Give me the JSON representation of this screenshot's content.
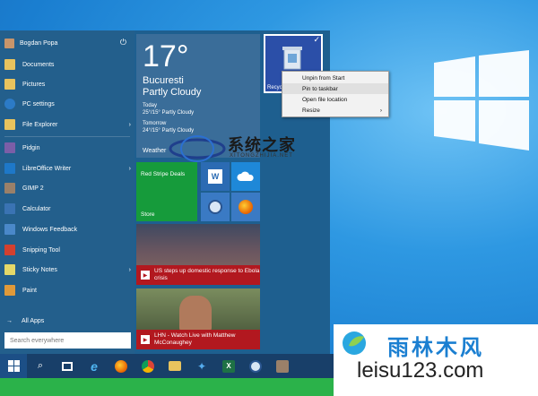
{
  "user": {
    "name": "Bogdan Popa"
  },
  "places": [
    {
      "label": "Documents",
      "icon": "folder-icon",
      "color": "#e8c35e"
    },
    {
      "label": "Pictures",
      "icon": "folder-icon",
      "color": "#e8c35e"
    },
    {
      "label": "PC settings",
      "icon": "gear-icon",
      "color": "#2c7bc7"
    },
    {
      "label": "File Explorer",
      "icon": "folder-icon",
      "color": "#e8c35e"
    }
  ],
  "apps": [
    {
      "label": "Pidgin",
      "icon": "pidgin-icon",
      "color": "#7b5ea7"
    },
    {
      "label": "LibreOffice Writer",
      "icon": "writer-icon",
      "color": "#1e78c8"
    },
    {
      "label": "GIMP 2",
      "icon": "gimp-icon",
      "color": "#9a8069"
    },
    {
      "label": "Calculator",
      "icon": "calculator-icon",
      "color": "#3a73b3"
    },
    {
      "label": "Windows Feedback",
      "icon": "feedback-icon",
      "color": "#4a88c9"
    },
    {
      "label": "Snipping Tool",
      "icon": "scissors-icon",
      "color": "#d3402f"
    },
    {
      "label": "Sticky Notes",
      "icon": "note-icon",
      "color": "#e4d869"
    },
    {
      "label": "Paint",
      "icon": "palette-icon",
      "color": "#e09a3a"
    }
  ],
  "all_apps": "All Apps",
  "search_placeholder": "Search everywhere",
  "weather": {
    "temp": "17°",
    "city": "Bucuresti",
    "condition": "Partly Cloudy",
    "today_label": "Today",
    "today_detail": "25°/15° Partly Cloudy",
    "tomorrow_label": "Tomorrow",
    "tomorrow_detail": "24°/15° Partly Cloudy",
    "tile_name": "Weather"
  },
  "recycle": {
    "label": "Recycle Bin"
  },
  "context_menu": {
    "items": [
      {
        "label": "Unpin from Start",
        "has_submenu": false
      },
      {
        "label": "Pin to taskbar",
        "has_submenu": false
      },
      {
        "label": "Open file location",
        "has_submenu": false
      },
      {
        "label": "Resize",
        "has_submenu": true
      }
    ],
    "arrow": "›"
  },
  "store": {
    "title": "Red Stripe Deals",
    "name": "Store"
  },
  "news": [
    {
      "text": "US steps up domestic response to Ebola crisis"
    },
    {
      "text": "LHN - Watch Live with Matthew McConaughey"
    }
  ],
  "watermark_top": {
    "text": "系统之家",
    "sub": "XITONGZHIJIA.NET"
  },
  "watermark_bottom": {
    "line1": "雨林木风",
    "line2": "leisu123.com"
  },
  "taskbar": [
    {
      "name": "search",
      "icon": "search-icon"
    },
    {
      "name": "task-view",
      "icon": "task-view-icon"
    },
    {
      "name": "ie",
      "icon": "internet-explorer-icon"
    },
    {
      "name": "firefox",
      "icon": "firefox-icon"
    },
    {
      "name": "chrome",
      "icon": "chrome-icon"
    },
    {
      "name": "explorer",
      "icon": "file-explorer-icon"
    },
    {
      "name": "twitter",
      "icon": "twitter-icon"
    },
    {
      "name": "excel",
      "icon": "excel-icon"
    },
    {
      "name": "thunderbird",
      "icon": "thunderbird-icon"
    },
    {
      "name": "gimp",
      "icon": "gimp-icon"
    }
  ]
}
